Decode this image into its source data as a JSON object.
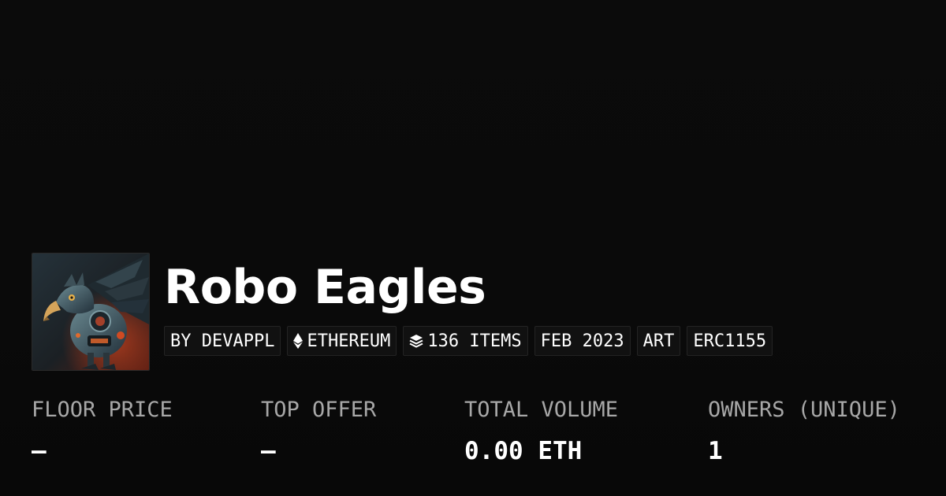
{
  "collection": {
    "name": "Robo Eagles",
    "thumbnail_icon": "robot-eagle-image"
  },
  "tags": [
    {
      "label": "BY DEVAPPL",
      "icon": null
    },
    {
      "label": "ETHEREUM",
      "icon": "ethereum-icon"
    },
    {
      "label": "136 ITEMS",
      "icon": "layers-icon"
    },
    {
      "label": "FEB 2023",
      "icon": null
    },
    {
      "label": "ART",
      "icon": null
    },
    {
      "label": "ERC1155",
      "icon": null
    }
  ],
  "stats": {
    "floor_price": {
      "label": "FLOOR PRICE",
      "value": "–"
    },
    "top_offer": {
      "label": "TOP OFFER",
      "value": "–"
    },
    "total_volume": {
      "label": "TOTAL VOLUME",
      "value": "0.00 ETH"
    },
    "owners": {
      "label": "OWNERS (UNIQUE)",
      "value": "1"
    }
  },
  "colors": {
    "background": "#0a0a0a",
    "tag_background": "#111111",
    "label_gray": "#a7a7a7",
    "text": "#ffffff"
  }
}
